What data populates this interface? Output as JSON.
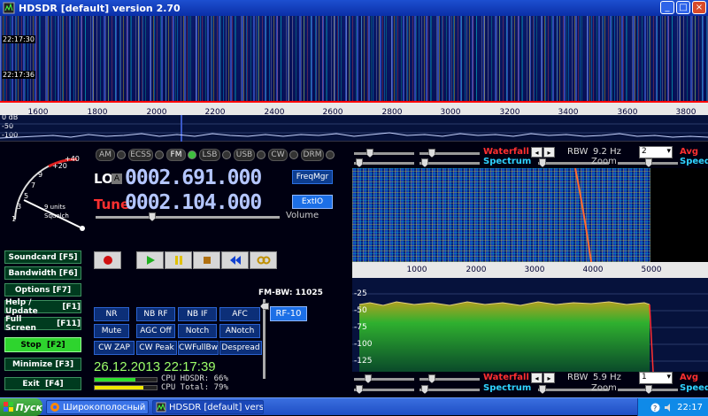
{
  "window": {
    "title": "HDSDR [default]  version 2.70",
    "minimize_glyph": "_",
    "maximize_glyph": "□",
    "close_glyph": "×"
  },
  "waterfall_top": {
    "timestamps": [
      "22:17:30",
      "22:17:36"
    ],
    "freq_ticks": [
      "1600",
      "1800",
      "2000",
      "2200",
      "2400",
      "2600",
      "2800",
      "3000",
      "3200",
      "3400",
      "3600",
      "3800"
    ]
  },
  "spectrum_top": {
    "db_labels": [
      "0 dB",
      "-50",
      "-100"
    ]
  },
  "modes": [
    {
      "label": "AM",
      "active": false
    },
    {
      "label": "ECSS",
      "active": false
    },
    {
      "label": "FM",
      "active": true
    },
    {
      "label": "LSB",
      "active": false
    },
    {
      "label": "USB",
      "active": false
    },
    {
      "label": "CW",
      "active": false
    },
    {
      "label": "DRM",
      "active": false
    }
  ],
  "smeter": {
    "scale_labels": [
      "+40",
      "+20",
      "9",
      "7",
      "5",
      "3",
      "1"
    ],
    "units_text": "9 units",
    "squelch_text": "Squelch"
  },
  "lo": {
    "label": "LO",
    "a_label": "A",
    "value": "0002.691.000"
  },
  "tune": {
    "label": "Tune",
    "value": "0002.104.000"
  },
  "freqmgr_label": "FreqMgr",
  "extio_label": "ExtIO",
  "volume_label": "Volume",
  "left_buttons": [
    {
      "label": "Soundcard",
      "key": "[F5]"
    },
    {
      "label": "Bandwidth",
      "key": "[F6]"
    },
    {
      "label": "Options",
      "key": "[F7]"
    },
    {
      "label": "Help / Update",
      "key": "[F1]"
    },
    {
      "label": "Full Screen",
      "key": "[F11]"
    },
    {
      "label": "Stop",
      "key": "[F2]"
    },
    {
      "label": "Minimize",
      "key": "[F3]"
    },
    {
      "label": "Exit",
      "key": "[F4]"
    }
  ],
  "dsp_buttons": [
    [
      "NR",
      "NB RF",
      "NB IF",
      "AFC"
    ],
    [
      "Mute",
      "AGC Off",
      "Notch",
      "ANotch"
    ],
    [
      "CW ZAP",
      "CW Peak",
      "CWFullBw",
      "Despread"
    ]
  ],
  "fm_bw": {
    "label": "FM-BW: 11025"
  },
  "rf_label": "RF-10",
  "datetime": "26.12.2013 22:17:39",
  "cpu": {
    "hdsdr_label": "CPU HDSDR:  66%",
    "total_label": "CPU Total:  79%",
    "hdsdr_fraction": 0.66,
    "total_fraction": 0.79,
    "hdsdr_color": "#2ee12e",
    "total_color": "#f0e800"
  },
  "rf_controls": {
    "waterfall_label": "Waterfall",
    "spectrum_label": "Spectrum",
    "zoom_label": "Zoom",
    "rbw_label": "RBW",
    "rbw_value": "9.2 Hz",
    "avg_label": "Avg",
    "avg_value": "2",
    "speed_label": "Speed"
  },
  "af_controls": {
    "waterfall_label": "Waterfall",
    "spectrum_label": "Spectrum",
    "zoom_label": "Zoom",
    "rbw_label": "RBW",
    "rbw_value": "5.9 Hz",
    "avg_label": "Avg",
    "avg_value": "1",
    "speed_label": "Speed"
  },
  "af_scale_ticks": [
    "1000",
    "2000",
    "3000",
    "4000",
    "5000"
  ],
  "af_db_labels": [
    "-25",
    "-50",
    "-75",
    "-100",
    "-125"
  ],
  "taskbar": {
    "start_label": "Пуск",
    "tasks": [
      "Широкополосный приё...",
      "HDSDR [default]  vers..."
    ],
    "clock": "22:17"
  },
  "colors": {
    "waterfall_label": "#ff3030",
    "spectrum_label": "#2fd3ff",
    "freq_digits": "#b4c6ff",
    "datetime": "#9cff6a"
  }
}
